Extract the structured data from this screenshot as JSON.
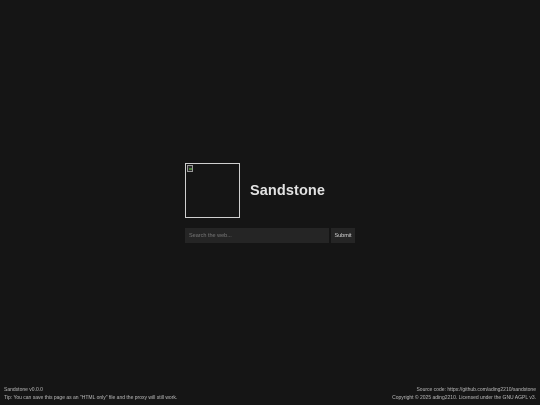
{
  "app": {
    "title": "Sandstone",
    "logo_icon": "broken-image-icon"
  },
  "search": {
    "placeholder": "Search the web...",
    "value": "",
    "submit_label": "Submit"
  },
  "footer": {
    "version": "Sandstone v0.0.0",
    "tip": "Tip: You can save this page as an \"HTML only\" file and the proxy will still work.",
    "source_prefix": "Source code: ",
    "source_link": "https://github.com/ading2210/sandstone",
    "copyright": "Copyright © 2025 ading2210. Licensed under the GNU AGPL v3."
  },
  "colors": {
    "background": "#151515",
    "input_background": "#252525",
    "text": "#dcdcdc"
  }
}
